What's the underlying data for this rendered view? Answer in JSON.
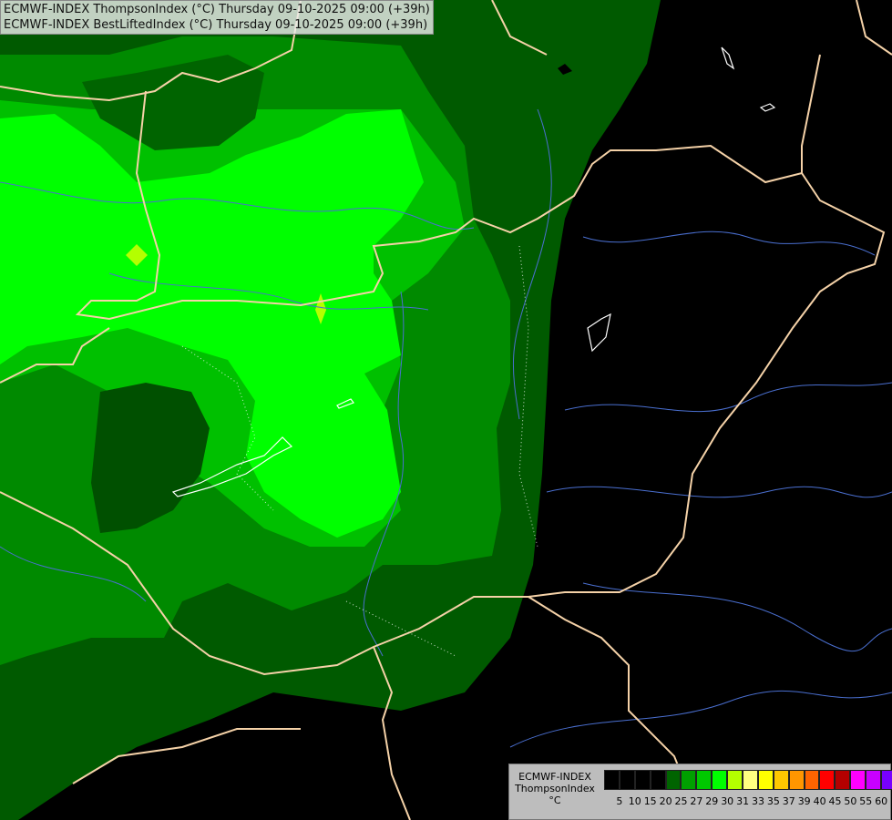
{
  "header": {
    "line1": "ECMWF-INDEX ThompsonIndex (°C) Thursday 09-10-2025 09:00 (+39h)",
    "line2": "ECMWF-INDEX BestLiftedIndex (°C) Thursday 09-10-2025 09:00 (+39h)"
  },
  "legend": {
    "line1": "ECMWF-INDEX",
    "line2": "ThompsonIndex",
    "line3": "°C",
    "colors": [
      "#000000",
      "#000000",
      "#000000",
      "#000000",
      "#006400",
      "#00a000",
      "#00c800",
      "#00ff00",
      "#b4ff00",
      "#ffff80",
      "#ffff00",
      "#ffc800",
      "#ff9600",
      "#ff6400",
      "#ff0000",
      "#b40000",
      "#ff00ff",
      "#c800ff",
      "#7800ff",
      "#0000ff"
    ],
    "ticks": [
      "5",
      "10",
      "15",
      "20",
      "25",
      "27",
      "29",
      "30",
      "31",
      "33",
      "35",
      "37",
      "39",
      "40",
      "45",
      "50",
      "55",
      "60"
    ]
  },
  "map": {
    "fill_colors": {
      "background": "#000000",
      "dark_green": "#005000",
      "green1": "#007800",
      "green2": "#00a000",
      "green3": "#00d200",
      "bright_green": "#00ff00",
      "yellow_green": "#b4ff00"
    },
    "border_color": "#f5d2a8",
    "river_color": "#4a6fd0"
  }
}
